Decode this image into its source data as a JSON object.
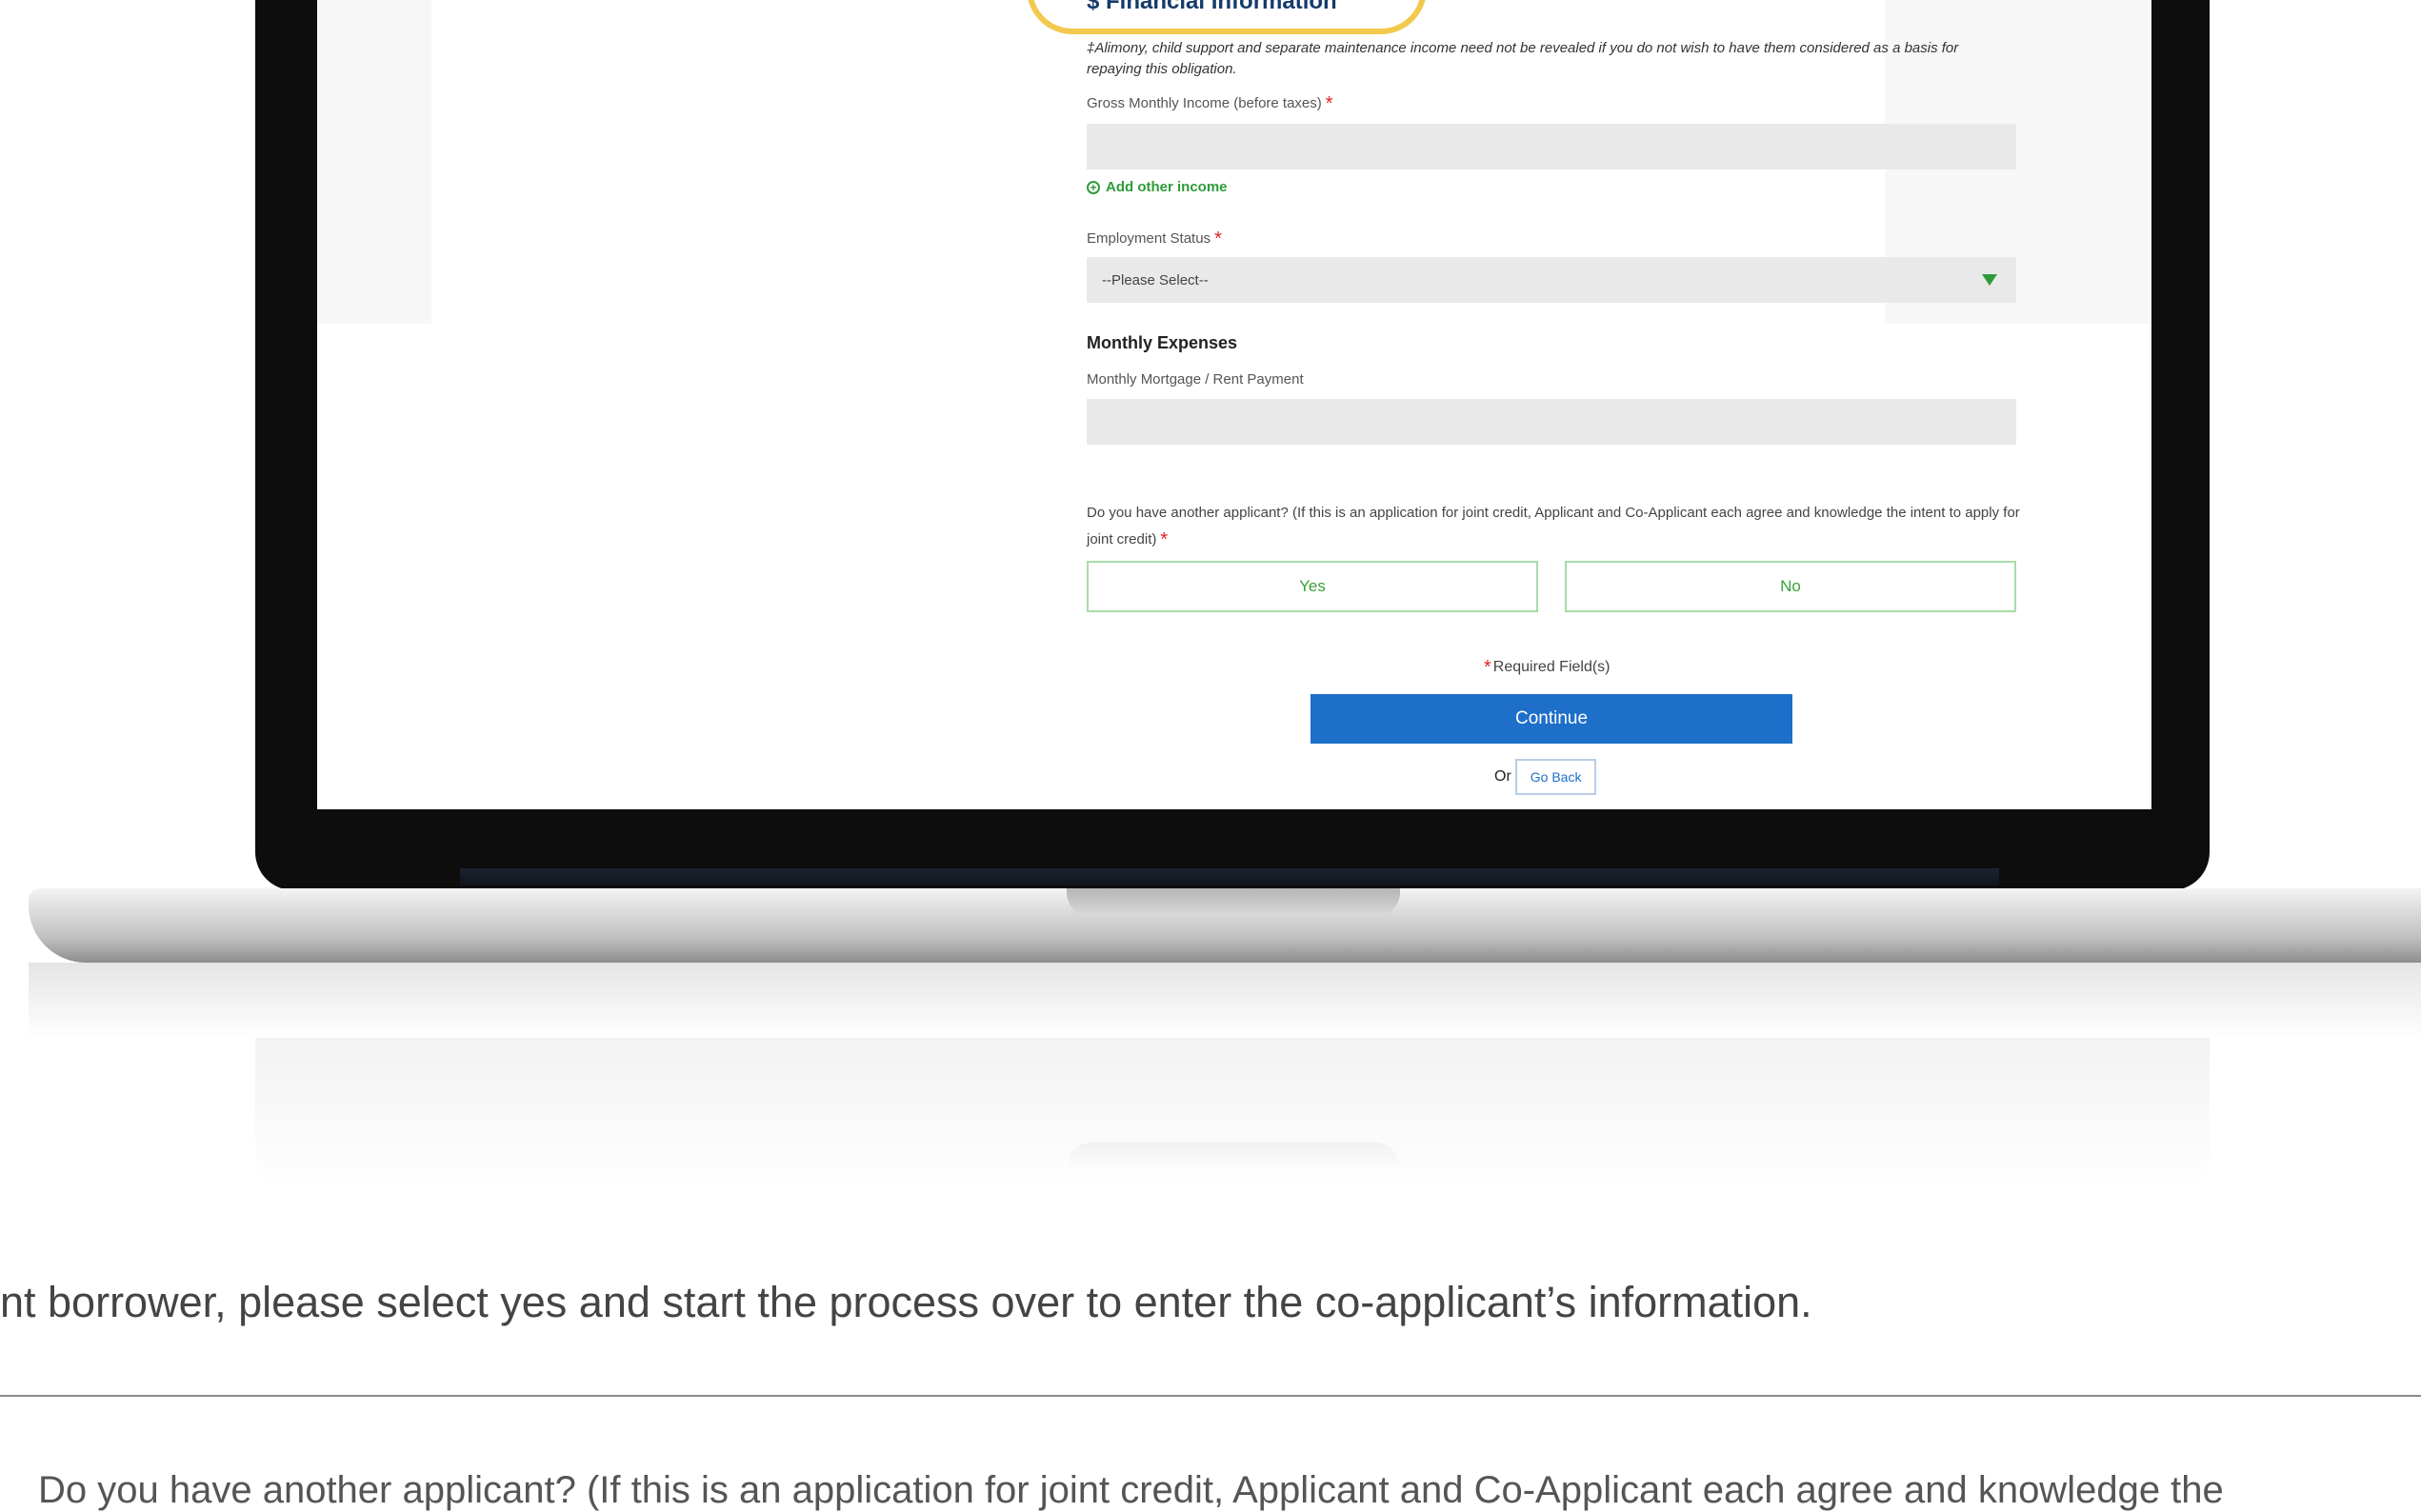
{
  "laptop_form": {
    "section_title": "$ Financial Information",
    "note": "‡Alimony, child support and separate maintenance income need not be revealed if you do not wish to have them considered as a basis for repaying this obligation.",
    "gross_income_label": "Gross Monthly Income (before taxes)",
    "add_income_label": "Add other income",
    "employment_label": "Employment Status",
    "employment_selected": "--Please Select--",
    "expenses_heading": "Monthly Expenses",
    "mortgage_label": "Monthly Mortgage / Rent Payment",
    "another_applicant_question": "Do you have another applicant? (If this is an application for joint credit, Applicant and Co-Applicant each agree and knowledge the intent to apply for joint credit)",
    "yes_label": "Yes",
    "no_label": "No",
    "required_note": "Required Field(s)",
    "required_mark": "*",
    "continue_label": "Continue",
    "or_label": "Or",
    "go_back_label": "Go Back"
  },
  "page": {
    "instruction_text": "nt borrower, please select yes and start the process over to enter the co-applicant’s information.",
    "cut_text": "Do you have another applicant? (If this is an application for joint credit, Applicant and Co-Applicant each agree and knowledge the"
  },
  "colors": {
    "accent_green": "#2e9b3a",
    "continue_blue": "#1d6fc9",
    "highlight_yellow": "#f2c94c",
    "required_red": "#d22222"
  },
  "icons": [
    "plus-circle-icon",
    "dropdown-caret-icon"
  ]
}
